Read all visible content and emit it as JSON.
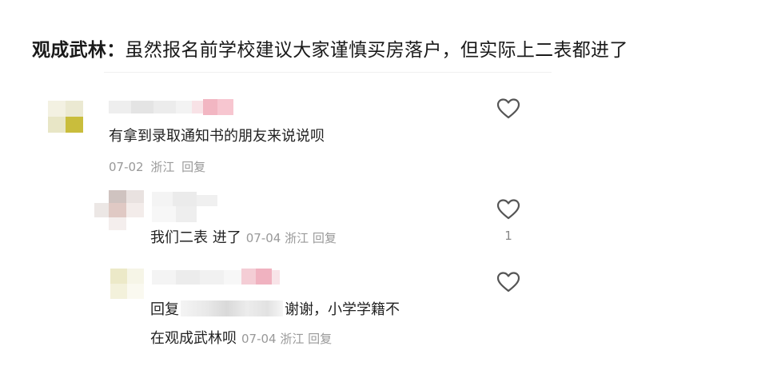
{
  "headline": {
    "name": "观成武林",
    "colon": "：",
    "text": "虽然报名前学校建议大家谨慎买房落户，但实际上二表都进了"
  },
  "comments": [
    {
      "text": "有拿到录取通知书的朋友来说说呗",
      "date": "07-02",
      "location": "浙江",
      "reply_label": "回复",
      "like_count": ""
    }
  ],
  "replies": [
    {
      "text": "我们二表 进了",
      "date": "07-04",
      "location": "浙江",
      "reply_label": "回复",
      "like_count": "1"
    },
    {
      "prefix": "回复",
      "text_after_mention": "谢谢，小学学籍不",
      "text_line2": "在观成武林呗",
      "date": "07-04",
      "location": "浙江",
      "reply_label": "回复",
      "like_count": ""
    }
  ],
  "colors": {
    "text": "#222222",
    "meta": "#999999",
    "heart_stroke": "#555555"
  }
}
